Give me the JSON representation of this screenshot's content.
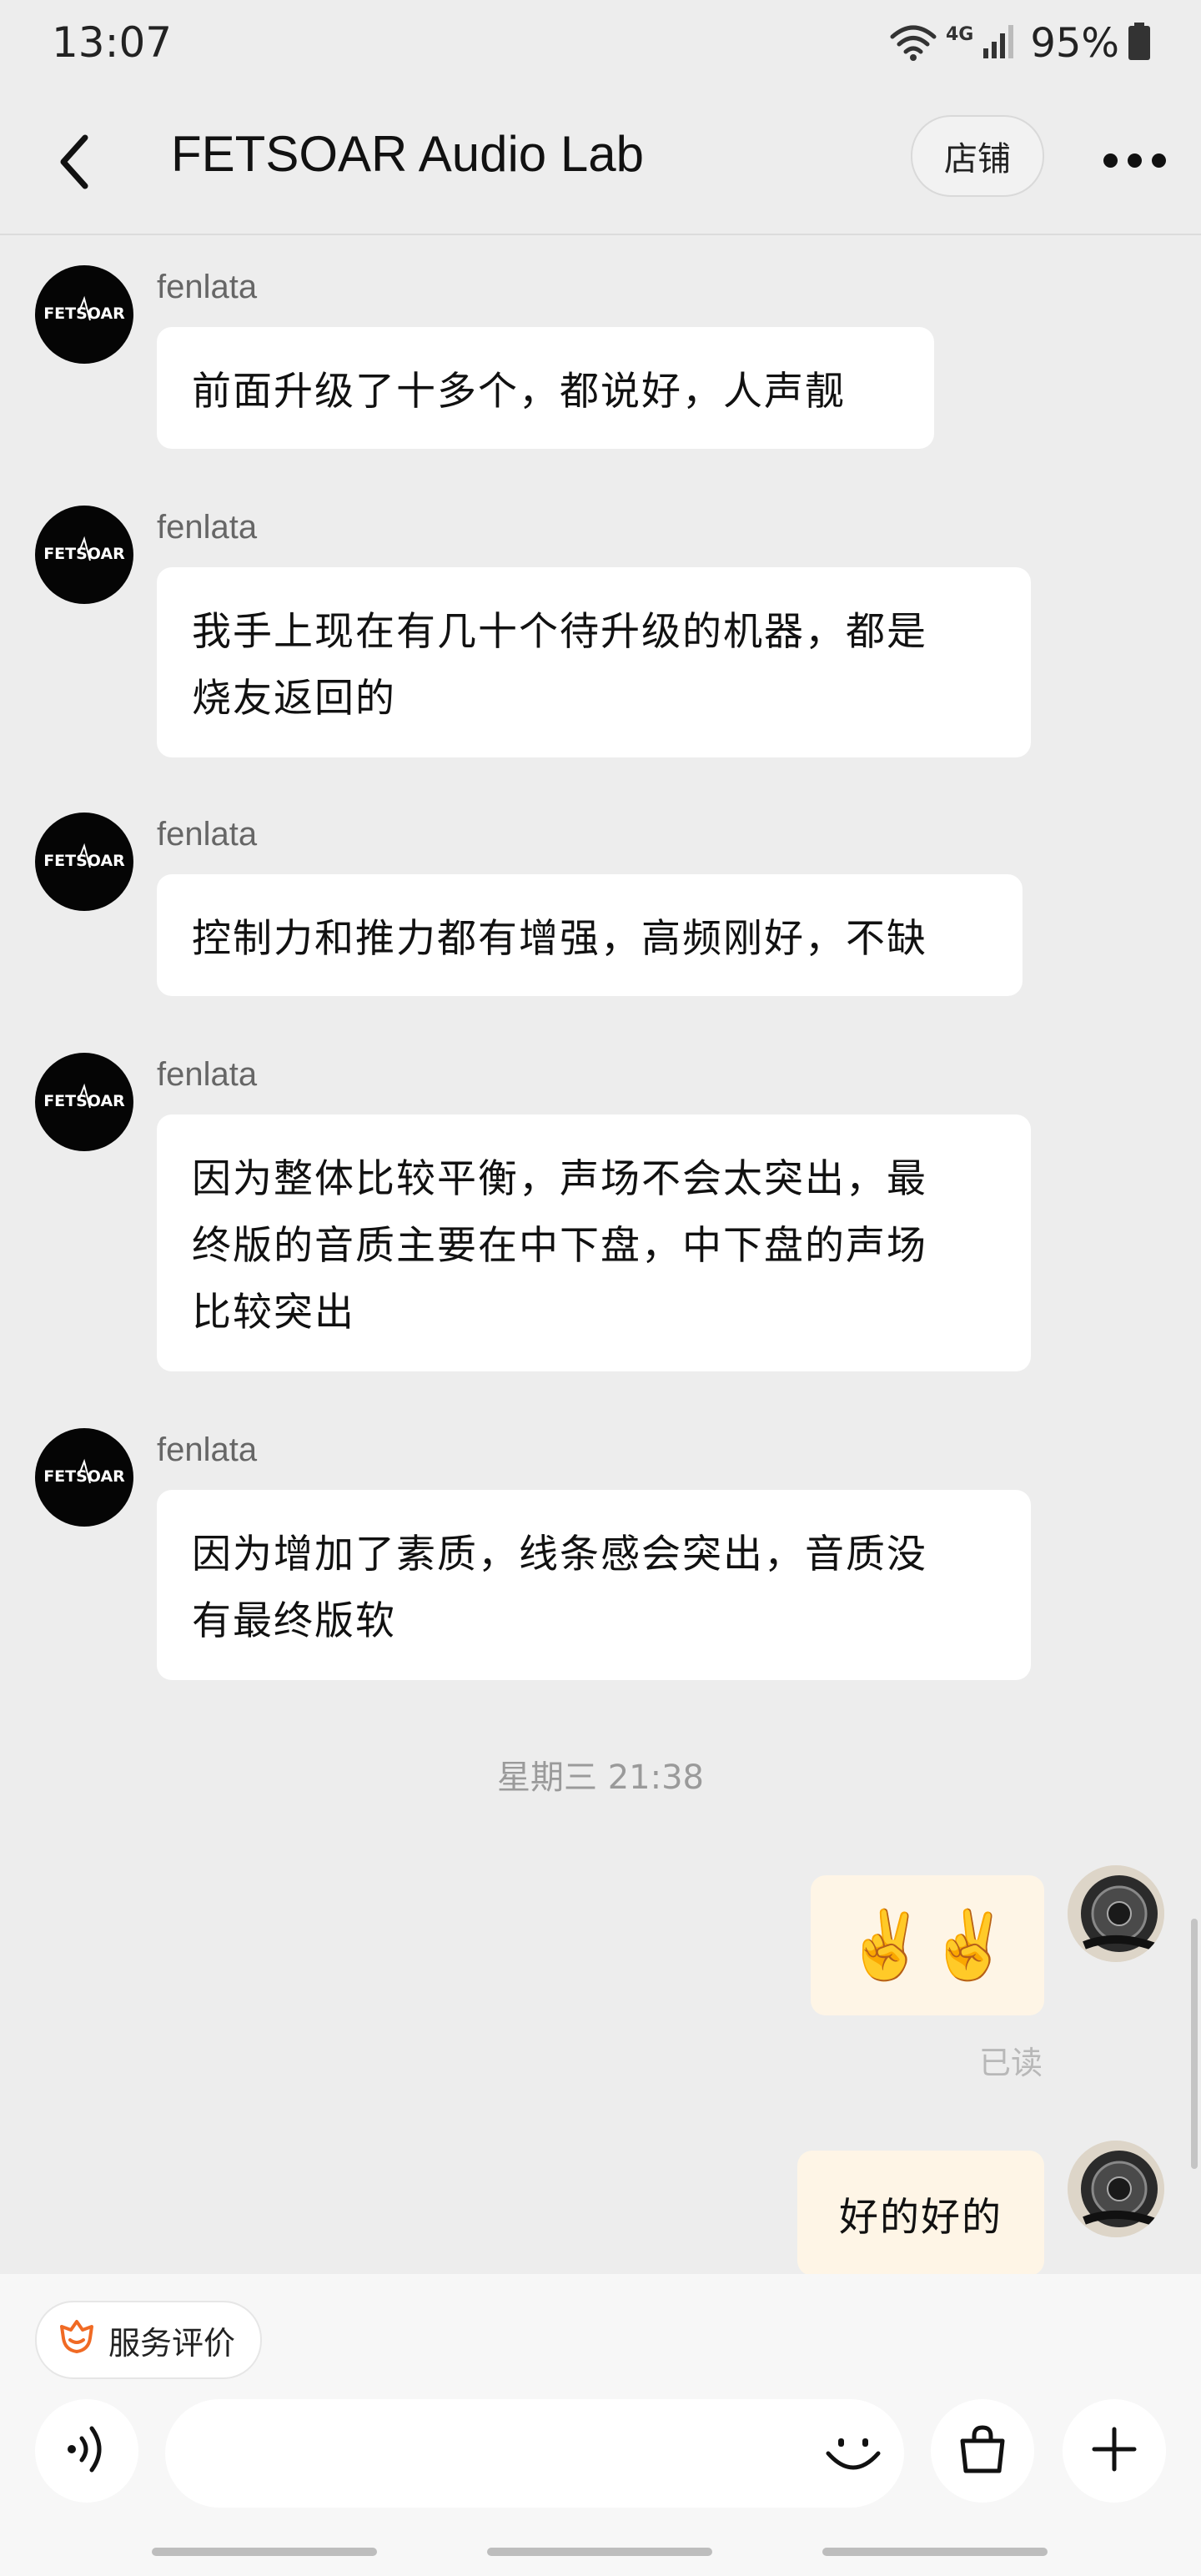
{
  "status_bar": {
    "time": "13:07",
    "network": "4G",
    "battery_percent": "95%",
    "icons": [
      "wifi-icon",
      "signal-icon",
      "battery-icon"
    ]
  },
  "header": {
    "back_icon": "chevron-left-icon",
    "title": "FETSOAR Audio Lab",
    "store_label": "店铺",
    "more_icon": "more-dots-icon"
  },
  "shop_avatar": {
    "logo_text": "FETSOAR",
    "background": "#050505"
  },
  "messages": [
    {
      "sender": "fenlata",
      "lines": [
        "前面升级了十多个，都说好，人声靓"
      ]
    },
    {
      "sender": "fenlata",
      "lines": [
        "我手上现在有几十个待升级的机器，都是",
        "烧友返回的"
      ]
    },
    {
      "sender": "fenlata",
      "lines": [
        "控制力和推力都有增强，高频刚好，不缺"
      ]
    },
    {
      "sender": "fenlata",
      "lines": [
        "因为整体比较平衡，声场不会太突出，最",
        "终版的音质主要在中下盘，中下盘的声场",
        "比较突出"
      ]
    },
    {
      "sender": "fenlata",
      "lines": [
        "因为增加了素质，线条感会突出，音质没",
        "有最终版软"
      ]
    }
  ],
  "timestamp": "星期三 21:38",
  "my_messages": [
    {
      "content": "✌️✌️",
      "read_receipt": "已读"
    },
    {
      "content": "好的好的"
    }
  ],
  "bottom": {
    "service_label": "服务评价",
    "service_icon": "flower-icon",
    "voice_icon": "voice-icon",
    "input_placeholder": "",
    "emoji_icon": "smiley-icon",
    "bag_icon": "shopping-bag-icon",
    "add_icon": "plus-icon"
  },
  "colors": {
    "background": "#ededed",
    "bubble_incoming": "#ffffff",
    "bubble_outgoing": "#fef5e6",
    "accent_service": "#f06a24"
  }
}
